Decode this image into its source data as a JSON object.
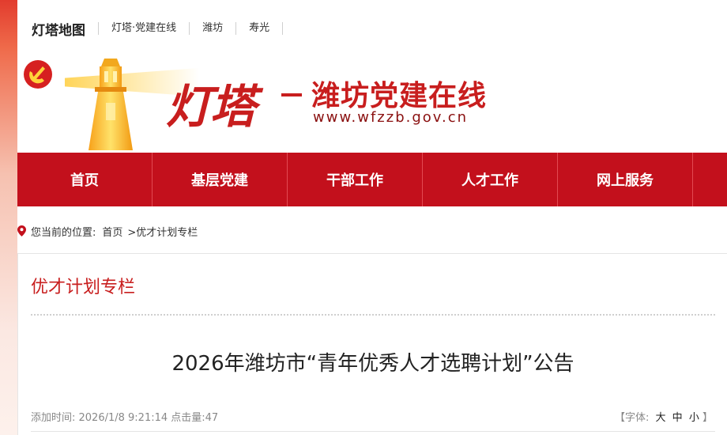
{
  "topbar": {
    "brand": "灯塔地图",
    "links": [
      "灯塔·党建在线",
      "潍坊",
      "寿光"
    ]
  },
  "banner": {
    "logo_script": "灯塔",
    "title": "潍坊党建在线",
    "url": "www.wfzzb.gov.cn"
  },
  "nav": {
    "items": [
      "首页",
      "基层党建",
      "干部工作",
      "人才工作",
      "网上服务"
    ]
  },
  "breadcrumb": {
    "prefix": "您当前的位置:",
    "home": "首页",
    "current": ">优才计划专栏"
  },
  "section": {
    "title": "优才计划专栏"
  },
  "article": {
    "title": "2026年潍坊市“青年优秀人才选聘计划”公告",
    "meta": "添加时间: 2026/1/8 9:21:14 点击量:47",
    "font_label": "【字体:",
    "font_large": "大",
    "font_medium": "中",
    "font_small": "小",
    "font_close": "】"
  },
  "colors": {
    "brand_red": "#c3101c",
    "title_red": "#c81e1e"
  }
}
